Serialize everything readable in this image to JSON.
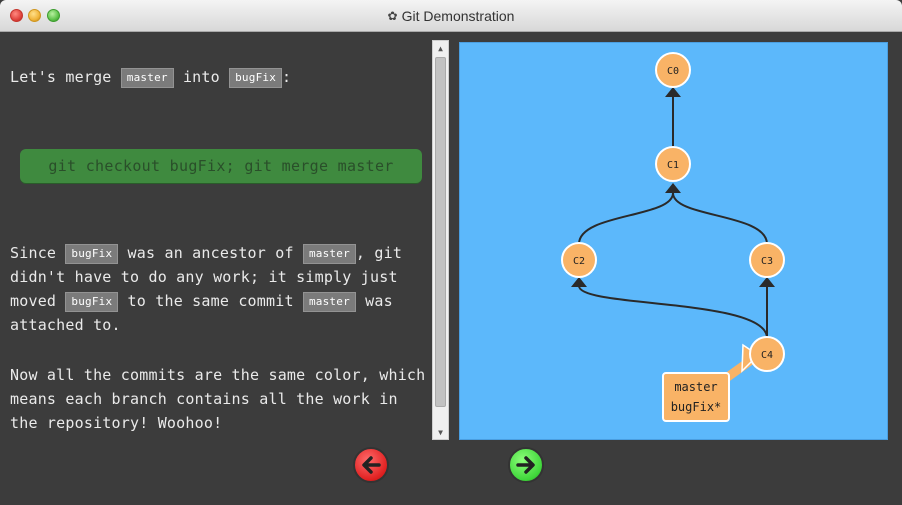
{
  "window": {
    "title": "Git Demonstration",
    "title_icon": "gear-icon"
  },
  "instructions": {
    "p1": {
      "pre": "Let's merge ",
      "tag1": "master",
      "mid": " into ",
      "tag2": "bugFix",
      "post": ":"
    },
    "command": "git checkout bugFix; git merge master",
    "p2": {
      "s1": "Since ",
      "tag1": "bugFix",
      "s2": " was an ancestor of ",
      "tag2": "master",
      "s3": ", git didn't have to do any work; it simply just moved ",
      "tag3": "bugFix",
      "s4": " to the same commit ",
      "tag4": "master",
      "s5": " was attached to."
    },
    "p3": "Now all the commits are the same color, which means each branch contains all the work in the repository! Woohoo!"
  },
  "graph": {
    "commits": [
      {
        "id": "C0",
        "parents": []
      },
      {
        "id": "C1",
        "parents": [
          "C0"
        ]
      },
      {
        "id": "C2",
        "parents": [
          "C1"
        ]
      },
      {
        "id": "C3",
        "parents": [
          "C1"
        ]
      },
      {
        "id": "C4",
        "parents": [
          "C2",
          "C3"
        ]
      }
    ],
    "branch_labels": [
      "master",
      "bugFix*"
    ],
    "head_commit": "C4"
  },
  "navigation": {
    "prev_icon": "arrow-left-icon",
    "next_icon": "arrow-right-icon"
  },
  "colors": {
    "canvas": "#5cb8fb",
    "commit": "#f9b366",
    "command_bg": "#3f8a3f",
    "prev_button": "#e02020",
    "next_button": "#3fd63a"
  }
}
